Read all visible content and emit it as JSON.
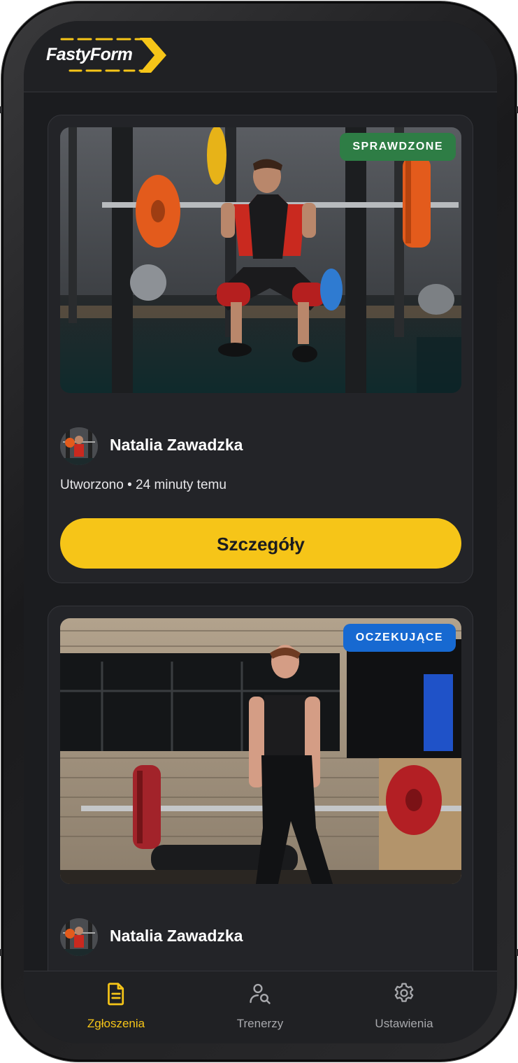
{
  "app": {
    "logo_text": "FastyForm",
    "brand_color": "#f6c518"
  },
  "submissions": [
    {
      "status": "SPRAWDZONE",
      "status_color": "#2e7d45",
      "photo": "squat-in-power-rack",
      "author": "Natalia Zawadzka",
      "meta": "Utworzono • 24 minuty temu",
      "details_label": "Szczegóły"
    },
    {
      "status": "OCZEKUJĄCE",
      "status_color": "#1769d1",
      "photo": "deadlift-lockout",
      "author": "Natalia Zawadzka",
      "meta": "",
      "details_label": ""
    }
  ],
  "tabs": [
    {
      "label": "Zgłoszenia",
      "icon": "document-icon",
      "active": true
    },
    {
      "label": "Trenerzy",
      "icon": "user-search-icon",
      "active": false
    },
    {
      "label": "Ustawienia",
      "icon": "gear-icon",
      "active": false
    }
  ]
}
